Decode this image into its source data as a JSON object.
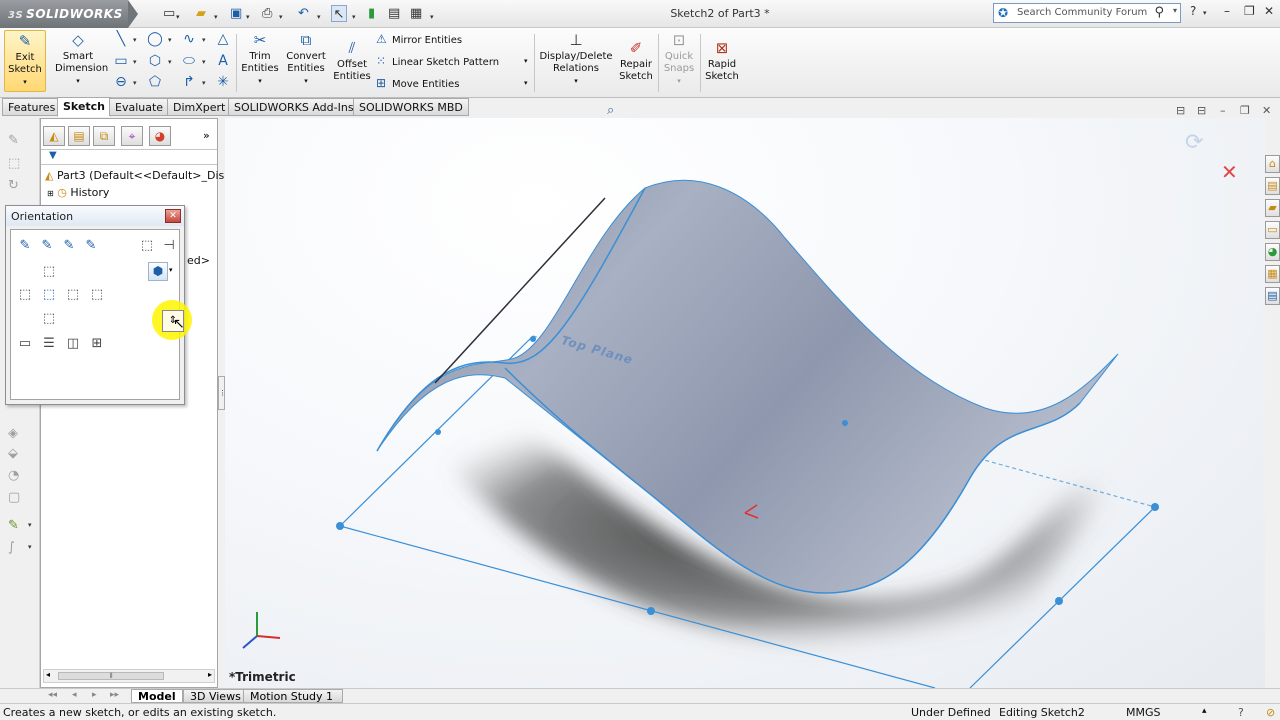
{
  "app": {
    "brand": "SOLIDWORKS",
    "brand_prefix": "3S",
    "doc_title": "Sketch2 of Part3 *"
  },
  "search": {
    "placeholder": "Search Community Forum"
  },
  "commands": {
    "exit_sketch": [
      "Exit",
      "Sketch"
    ],
    "smart_dimension": [
      "Smart",
      "Dimension"
    ],
    "trim_entities": [
      "Trim",
      "Entities"
    ],
    "convert_entities": [
      "Convert",
      "Entities"
    ],
    "offset_entities": [
      "Offset",
      "Entities"
    ],
    "mirror_entities": "Mirror Entities",
    "linear_sketch_pattern": "Linear Sketch Pattern",
    "move_entities": "Move Entities",
    "display_delete_relations": [
      "Display/Delete",
      "Relations"
    ],
    "repair_sketch": [
      "Repair",
      "Sketch"
    ],
    "quick_snaps": [
      "Quick",
      "Snaps"
    ],
    "rapid_sketch": [
      "Rapid",
      "Sketch"
    ]
  },
  "tabs": [
    "Features",
    "Sketch",
    "Evaluate",
    "DimXpert",
    "SOLIDWORKS Add-Ins",
    "SOLIDWORKS MBD"
  ],
  "active_tab": "Sketch",
  "feature_tree": {
    "part": "Part3  (Default<<Default>_Disp",
    "history": "History",
    "partial_text": "ed>"
  },
  "orientation_dialog": {
    "title": "Orientation"
  },
  "viewport": {
    "plane_label": "Top Plane",
    "view_name": "*Trimetric"
  },
  "bottom_tabs": [
    "Model",
    "3D Views",
    "Motion Study 1"
  ],
  "active_bottom_tab": "Model",
  "status": {
    "message": "Creates a new sketch, or edits an existing sketch.",
    "definition": "Under Defined",
    "editing": "Editing Sketch2",
    "units": "MMGS"
  },
  "colors": {
    "accent": "#1c5ea8",
    "surface": "#9aa3b8",
    "sketch_line": "#3a8fd6"
  }
}
